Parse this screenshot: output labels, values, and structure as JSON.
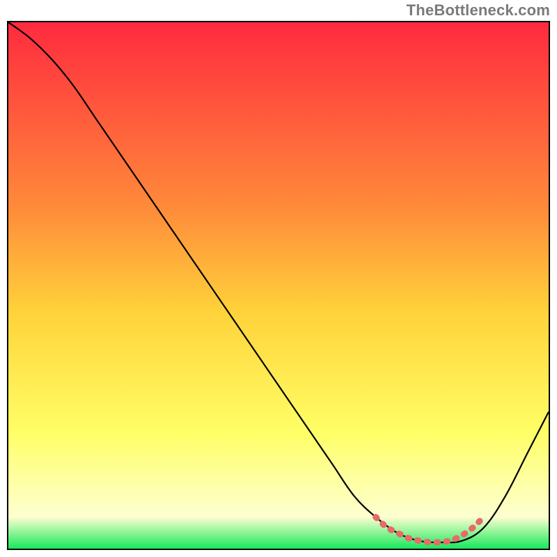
{
  "watermark": "TheBottleneck.com",
  "colors": {
    "gradient_top": "#ff2a3f",
    "gradient_mid1": "#ff8a3a",
    "gradient_mid2": "#ffd23a",
    "gradient_mid3": "#ffff66",
    "gradient_bottom_light": "#fdffd0",
    "gradient_bottom": "#18e85a",
    "curve": "#000000",
    "highlight": "#e86a6a"
  },
  "chart_data": {
    "type": "line",
    "title": "",
    "xlabel": "",
    "ylabel": "",
    "xlim": [
      0,
      100
    ],
    "ylim": [
      0,
      100
    ],
    "series": [
      {
        "name": "curve",
        "x": [
          0,
          4,
          8,
          12,
          16,
          20,
          24,
          28,
          32,
          36,
          40,
          44,
          48,
          52,
          56,
          60,
          64,
          68,
          72,
          76,
          80,
          84,
          88,
          92,
          96,
          100
        ],
        "y": [
          100,
          97,
          93,
          88,
          82,
          76,
          70,
          64,
          58,
          52,
          46,
          40,
          34,
          28,
          22,
          16,
          10,
          6,
          3,
          1.5,
          1.2,
          1.5,
          4,
          10,
          18,
          26
        ]
      },
      {
        "name": "highlight",
        "x": [
          68,
          70,
          72,
          74,
          76,
          78,
          80,
          82,
          84,
          86,
          88
        ],
        "y": [
          6,
          4,
          3,
          2,
          1.5,
          1.2,
          1.2,
          1.5,
          2.5,
          4,
          6
        ]
      }
    ],
    "annotations": []
  }
}
